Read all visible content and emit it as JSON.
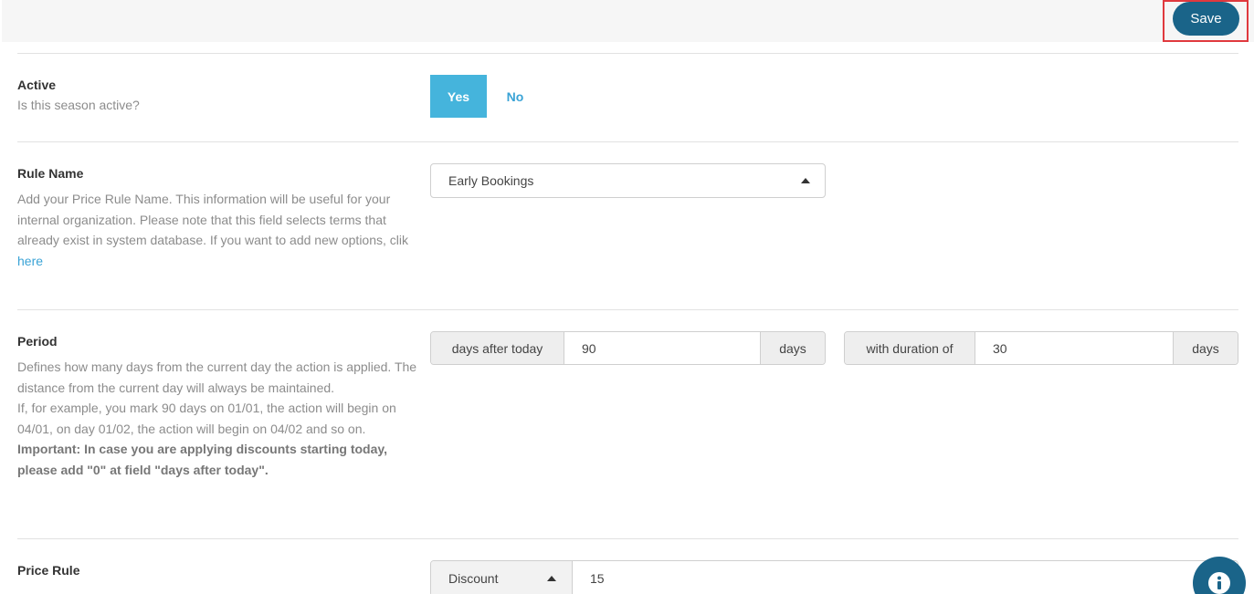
{
  "toolbar": {
    "save_label": "Save"
  },
  "active": {
    "title": "Active",
    "description": "Is this season active?",
    "yes_label": "Yes",
    "no_label": "No",
    "selected": "Yes"
  },
  "rule_name": {
    "title": "Rule Name",
    "description": "Add your Price Rule Name. This information will be useful for your internal organization. Please note that this field selects terms that already exist in system database. If you want to add new options, clik",
    "link_text": "here",
    "selected_value": "Early Bookings"
  },
  "period": {
    "title": "Period",
    "desc_1": "Defines how many days from the current day the action is applied. The distance from the current day will always be maintained.",
    "desc_2": "If, for example, you mark 90 days on 01/01, the action will begin on 04/01, on day 01/02, the action will begin on 04/02 and so on.",
    "desc_important": "Important: In case you are applying discounts starting today, please add \"0\" at field \"days after today\".",
    "after_today_label": "days after today",
    "after_today_value": "90",
    "after_today_unit": "days",
    "duration_label": "with duration of",
    "duration_value": "30",
    "duration_unit": "days"
  },
  "price_rule": {
    "title": "Price Rule",
    "type_value": "Discount",
    "amount_value": "15"
  },
  "colors": {
    "primary": "#1a6489",
    "accent": "#45b4dc",
    "link": "#3aa3d6",
    "highlight_border": "#e0393e"
  },
  "icons": {
    "select_caret": "caret-up-icon",
    "info": "info-icon"
  }
}
